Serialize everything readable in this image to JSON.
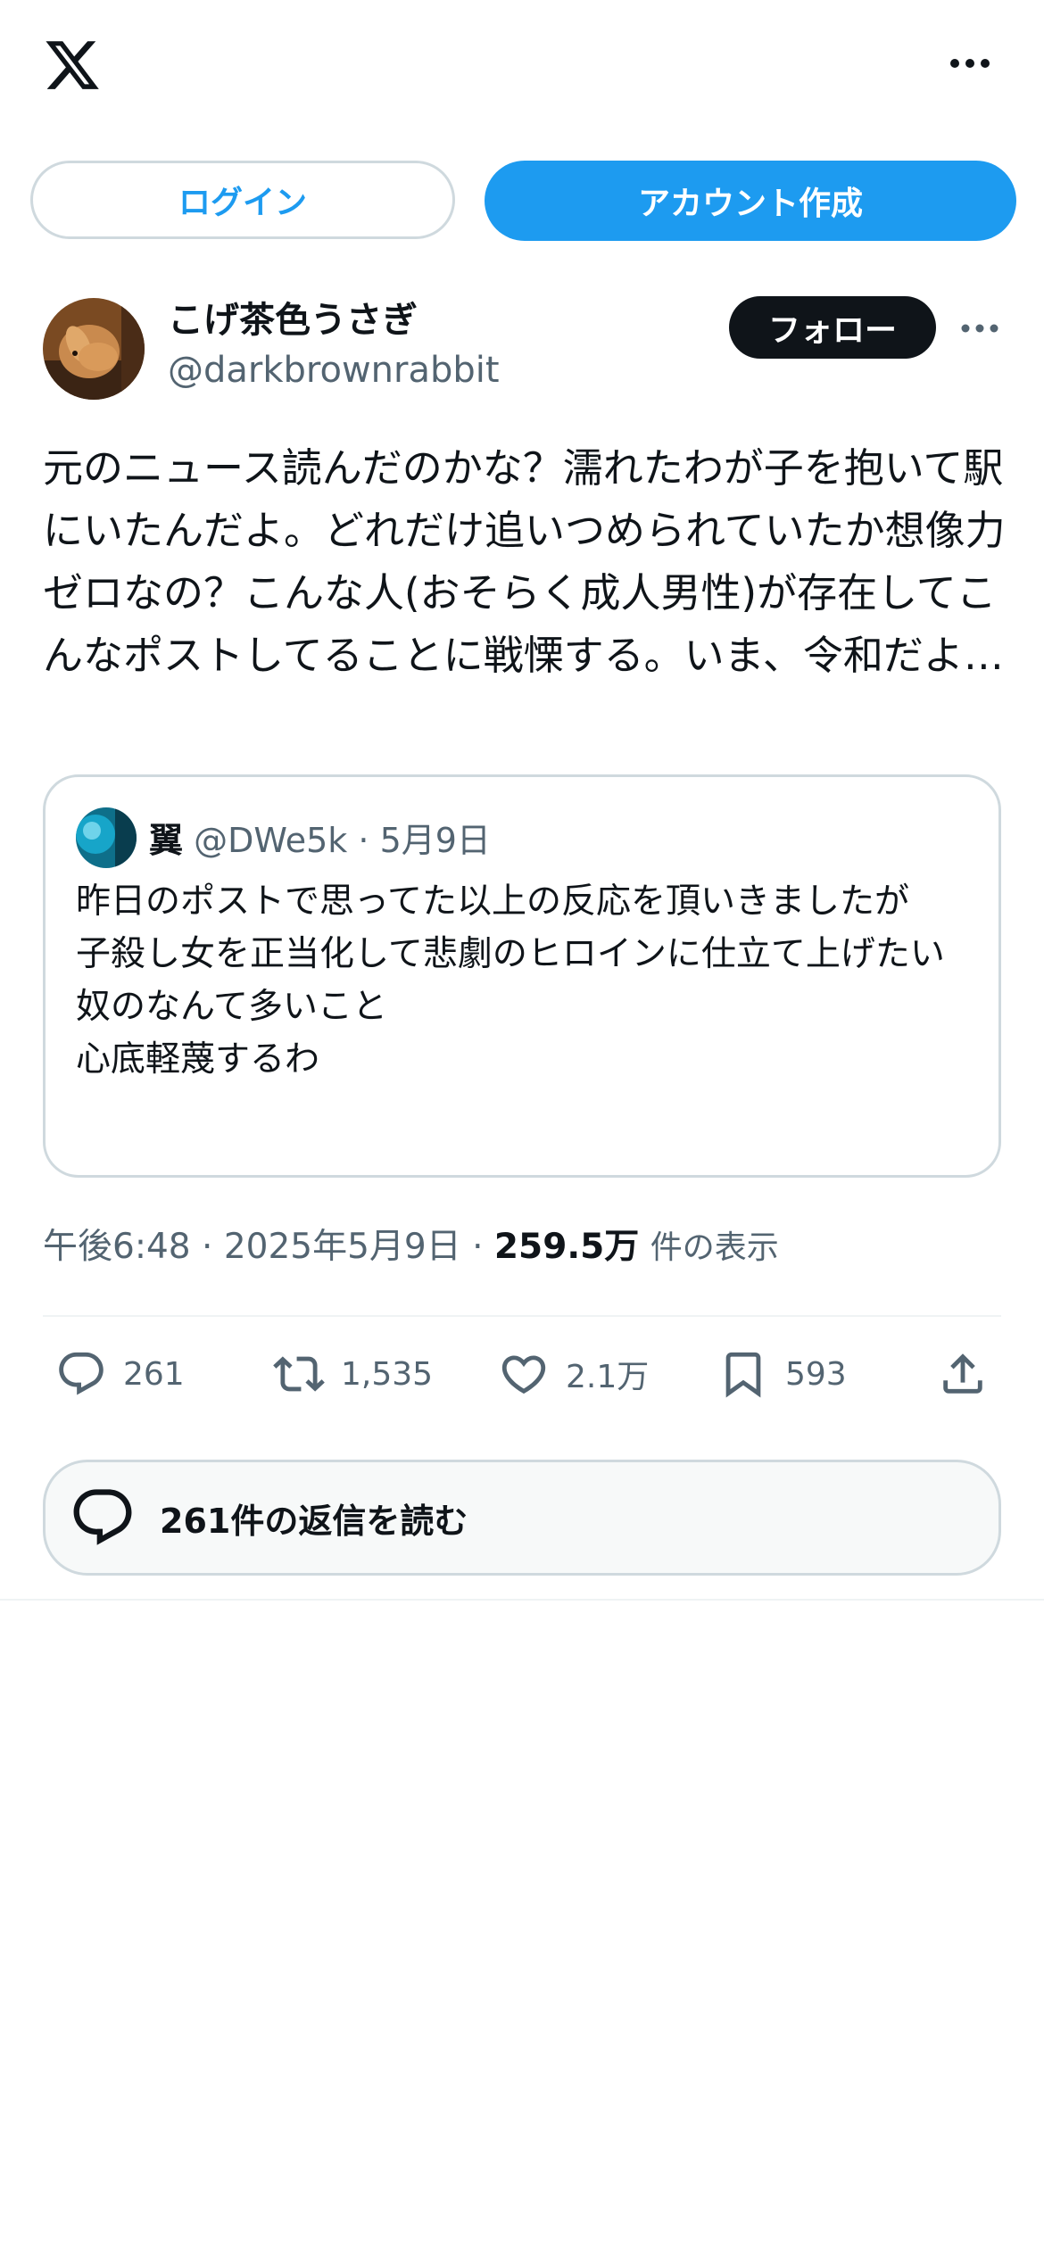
{
  "colors": {
    "accent": "#1d9bf0",
    "text_primary": "#0f1419",
    "text_secondary": "#536471",
    "border": "#cfd9de"
  },
  "topbar": {
    "logo_icon": "x-logo-icon",
    "more_icon": "more-horizontal-icon"
  },
  "auth": {
    "login_label": "ログイン",
    "signup_label": "アカウント作成"
  },
  "post": {
    "author": {
      "display_name": "こげ茶色うさぎ",
      "handle": "@darkbrownrabbit",
      "avatar_icon": "rabbit-photo-avatar"
    },
    "follow_label": "フォロー",
    "text": "元のニュース読んだのかな？濡れたわが子を抱いて駅にいたんだよ。どれだけ追いつめられていたか想像力ゼロなの？こんな人(おそらく成人男性)が存在してこんなポストしてることに戦慄する。いま、令和だよ…",
    "quote": {
      "name": "翼",
      "handle": "@DWe5k",
      "separator": "·",
      "date": "5月9日",
      "text": "昨日のポストで思ってた以上の反応を頂いきましたが\n子殺し女を正当化して悲劇のヒロインに仕立て上げたい奴のなんて多いこと\n心底軽蔑するわ"
    },
    "time": "午後6:48",
    "separator": "·",
    "date": "2025年5月9日",
    "views": "259.5万",
    "views_label": "件の表示"
  },
  "actions": {
    "reply_count": "261",
    "repost_count": "1,535",
    "like_count": "2.1万",
    "bookmark_count": "593"
  },
  "replies_button": {
    "label": "261件の返信を読む"
  }
}
